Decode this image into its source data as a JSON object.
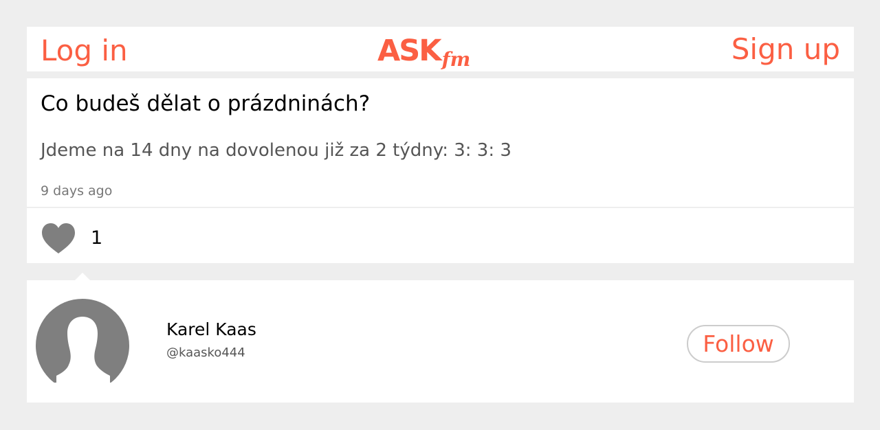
{
  "header": {
    "login_label": "Log in",
    "logo_text": "ASK",
    "logo_suffix": "fm",
    "signup_label": "Sign up"
  },
  "question": {
    "text": "Co budeš dělat o prázdninách?",
    "answer": "Jdeme na 14 dny na dovolenou již za 2 týdny: 3: 3: 3",
    "time_ago": "9 days ago"
  },
  "actions": {
    "like_icon": "heart-icon",
    "like_count": "1"
  },
  "profile": {
    "avatar_icon": "default-user-silhouette",
    "name": "Karel Kaas",
    "handle": "@kaasko444",
    "follow_label": "Follow"
  },
  "colors": {
    "brand": "#fb5f43",
    "background": "#eeeeee",
    "card": "#ffffff",
    "icon_gray": "#7f7f7f",
    "follow_border": "#cccccc"
  }
}
